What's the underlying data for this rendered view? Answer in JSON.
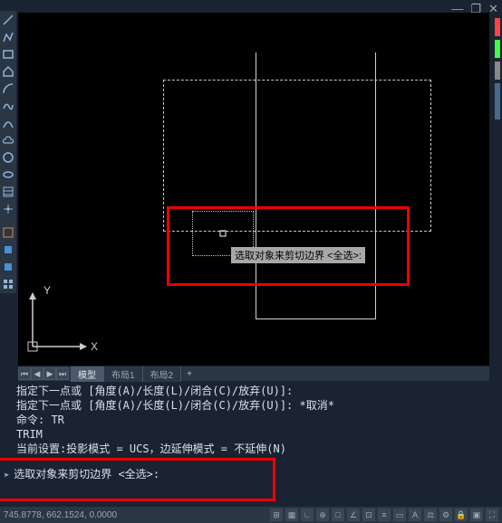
{
  "window_controls": {
    "minimize": "—",
    "restore": "❐",
    "close": "✕"
  },
  "toolbar_icons": [
    "line",
    "polyline",
    "rect",
    "home",
    "arc",
    "curve1",
    "curve2",
    "cloud",
    "circle",
    "ellipse",
    "hatch",
    "select",
    "move",
    "layer",
    "layer2",
    "grid"
  ],
  "ucs": {
    "x": "X",
    "y": "Y"
  },
  "tabs": {
    "model": "模型",
    "layout1": "布局1",
    "layout2": "布局2",
    "plus": "+"
  },
  "tooltip": "选取对象来剪切边界 <全选>:",
  "cmd": {
    "l1": "指定下一点或 [角度(A)/长度(L)/闭合(C)/放弃(U)]:",
    "l2": "指定下一点或 [角度(A)/长度(L)/闭合(C)/放弃(U)]: *取消*",
    "l3": "命令: TR",
    "l4": "TRIM",
    "l5": "当前设置:投影模式 = UCS，边延伸模式 = 不延伸(N)",
    "prompt": "选取对象来剪切边界 <全选>:"
  },
  "status": {
    "coord": "745.8778, 662.1524, 0.0000"
  },
  "colors": {
    "red": "#e00000"
  }
}
